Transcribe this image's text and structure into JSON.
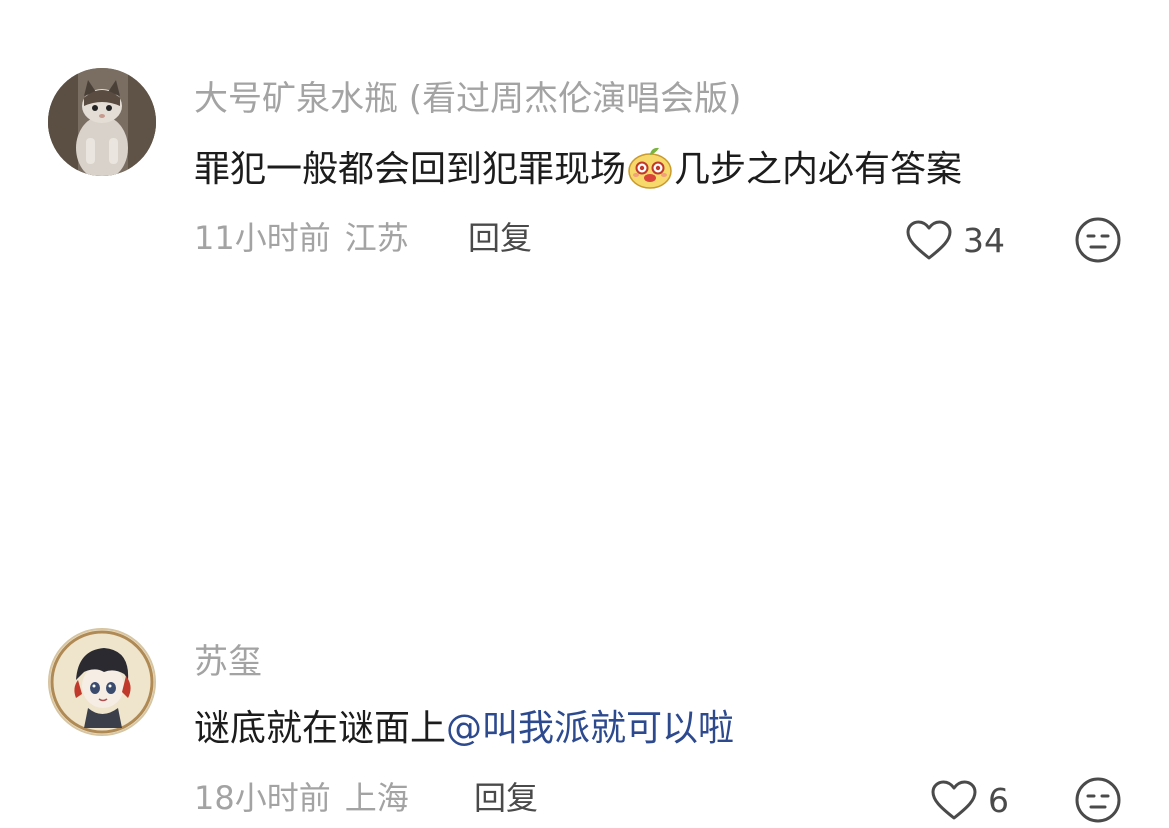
{
  "comments": [
    {
      "username": "大号矿泉水瓶 (看过周杰伦演唱会版)",
      "text_before": "罪犯一般都会回到犯罪现场",
      "emoji": "cute-face-emoji",
      "text_after": "几步之内必有答案",
      "time": "11小时前",
      "location": "江苏",
      "reply_label": "回复",
      "likes": "34"
    },
    {
      "username": "苏玺",
      "text_before": "谜底就在谜面上",
      "mention": "@叫我派就可以啦",
      "time": "18小时前",
      "location": "上海",
      "reply_label": "回复",
      "likes": "6"
    }
  ],
  "colors": {
    "muted_text": "#a3a3a3",
    "body_text": "#1c1c1c",
    "mention": "#2d4a8f",
    "icon": "#4a4a4a"
  }
}
